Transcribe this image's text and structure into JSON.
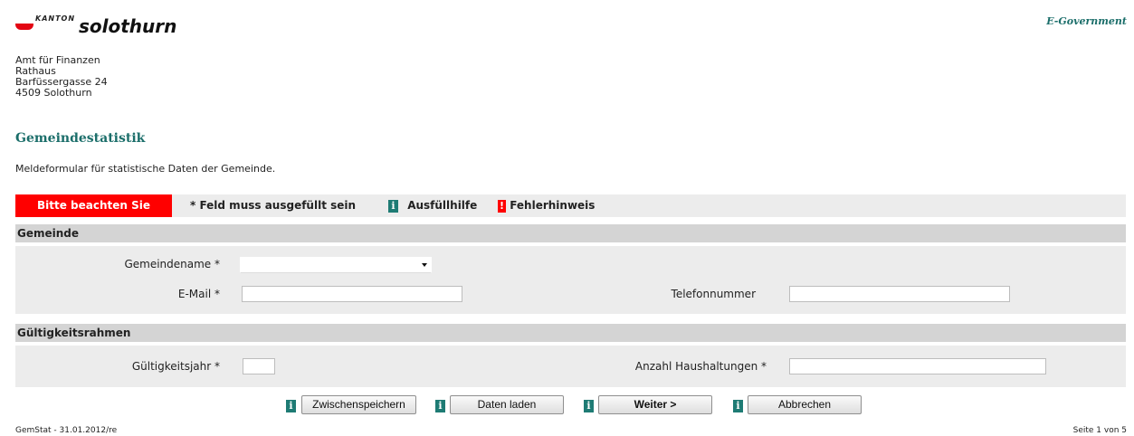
{
  "header": {
    "logo_kanton": "KANTON",
    "logo_name": "solothurn",
    "egov": "E-Government"
  },
  "address": [
    "Amt für Finanzen",
    "Rathaus",
    "Barfüssergasse 24",
    "4509 Solothurn"
  ],
  "page_title": "Gemeindestatistik",
  "subtitle": "Meldeformular für statistische Daten der Gemeinde.",
  "legend": {
    "notice": "Bitte beachten Sie",
    "required": "* Feld muss ausgefüllt sein",
    "info_icon": "i",
    "help": "Ausfüllhilfe",
    "error_icon": "!",
    "error": "Fehlerhinweis"
  },
  "sections": {
    "gemeinde": {
      "title": "Gemeinde",
      "gemeindename_label": "Gemeindename *",
      "gemeindename_value": "",
      "email_label": "E-Mail *",
      "email_value": "",
      "telefon_label": "Telefonnummer",
      "telefon_value": ""
    },
    "gueltigkeit": {
      "title": "Gültigkeitsrahmen",
      "jahr_label": "Gültigkeitsjahr *",
      "jahr_value": "",
      "haushalt_label": "Anzahl Haushaltungen *",
      "haushalt_value": ""
    }
  },
  "buttons": {
    "save": "Zwischenspeichern",
    "load": "Daten laden",
    "next": "Weiter >",
    "cancel": "Abbrechen"
  },
  "footer": {
    "version": "GemStat - 31.01.2012/re",
    "page": "Seite 1 von 5"
  },
  "colors": {
    "accent": "#1b6e6a",
    "notice_red": "#ff0000",
    "info_teal": "#1e7b74"
  }
}
